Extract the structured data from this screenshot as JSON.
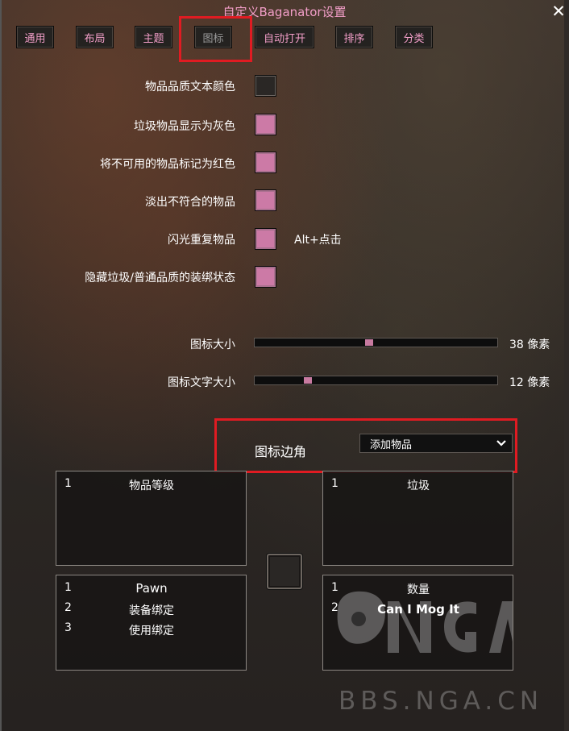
{
  "window": {
    "title": "自定义Baganator设置",
    "close_icon": "close-icon"
  },
  "tabs": [
    {
      "label": "通用"
    },
    {
      "label": "布局"
    },
    {
      "label": "主题"
    },
    {
      "label": "图标",
      "active": true
    },
    {
      "label": "自动打开"
    },
    {
      "label": "排序"
    },
    {
      "label": "分类"
    }
  ],
  "options": [
    {
      "label": "物品品质文本颜色",
      "checked": false
    },
    {
      "label": "垃圾物品显示为灰色",
      "checked": true
    },
    {
      "label": "将不可用的物品标记为红色",
      "checked": true
    },
    {
      "label": "淡出不符合的物品",
      "checked": true
    },
    {
      "label": "闪光重复物品",
      "checked": true,
      "hint": "Alt+点击"
    },
    {
      "label": "隐藏垃圾/普通品质的装绑状态",
      "checked": true
    }
  ],
  "sliders": [
    {
      "label": "图标大小",
      "value_text": "38 像素",
      "fraction": 0.47
    },
    {
      "label": "图标文字大小",
      "value_text": "12 像素",
      "fraction": 0.21
    }
  ],
  "corner": {
    "label": "图标边角",
    "dropdown_value": "添加物品"
  },
  "corner_boxes": {
    "top_left": [
      {
        "num": "1",
        "text": "物品等级"
      }
    ],
    "top_right": [
      {
        "num": "1",
        "text": "垃圾"
      }
    ],
    "bottom_left": [
      {
        "num": "1",
        "text": "Pawn"
      },
      {
        "num": "2",
        "text": "装备绑定"
      },
      {
        "num": "3",
        "text": "使用绑定"
      }
    ],
    "bottom_right": [
      {
        "num": "1",
        "text": "数量"
      },
      {
        "num": "2",
        "text": "Can I Mog It"
      }
    ]
  },
  "watermark": {
    "logo_text": "NGA",
    "site": "BBS.NGA.CN"
  },
  "colors": {
    "accent_pink": "#f29ec8",
    "checkbox_on": "#cc7aa6",
    "highlight_red": "#e01b22"
  }
}
